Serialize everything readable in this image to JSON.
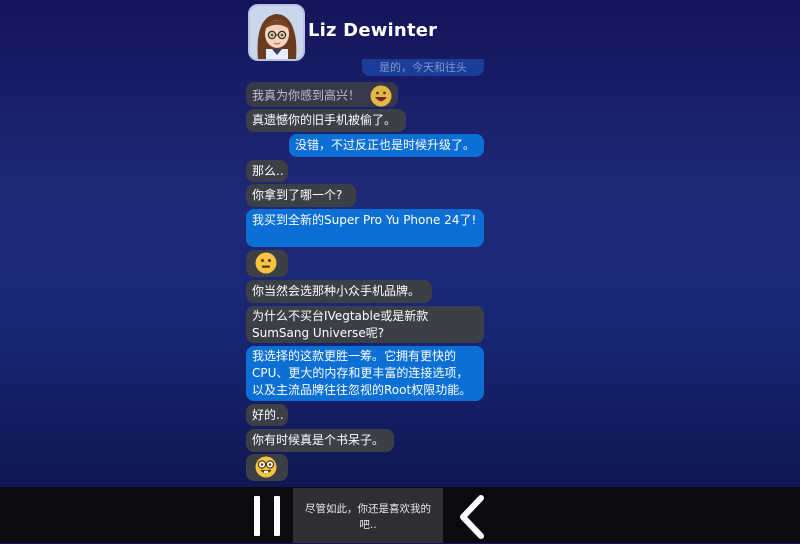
{
  "header": {
    "contact_name": "Liz Dewinter",
    "faded_text": "是的，今天和往头"
  },
  "messages": [
    {
      "side": "in",
      "text": "我真为你感到高兴！",
      "icon": "grin-emoji-icon"
    },
    {
      "side": "in",
      "text": "真遗憾你的旧手机被偷了。"
    },
    {
      "side": "out",
      "text": "没错，不过反正也是时候升级了。"
    },
    {
      "side": "in",
      "text": "那么.."
    },
    {
      "side": "in",
      "text": "你拿到了哪一个?"
    },
    {
      "side": "out",
      "text": "我买到全新的Super Pro Yu Phone 24了!"
    },
    {
      "side": "in",
      "icon": "surprised-emoji-icon"
    },
    {
      "side": "in",
      "text": "你当然会选那种小众手机品牌。"
    },
    {
      "side": "in",
      "text": "为什么不买台IVegtable或是新款SumSang Universe呢?"
    },
    {
      "side": "out",
      "text": "我选择的这款更胜一筹。它拥有更快的CPU、更大的内存和更丰富的连接选项，以及主流品牌往往忽视的Root权限功能。"
    },
    {
      "side": "in",
      "text": "好的.."
    },
    {
      "side": "in",
      "text": "你有时候真是个书呆子。"
    },
    {
      "side": "in",
      "icon": "nerd-emoji-icon"
    }
  ],
  "controls": {
    "choice_text": "尽管如此，你还是喜欢我的吧..",
    "pause_icon": "pause-icon",
    "back_icon": "chevron-left-icon"
  },
  "colors": {
    "incoming_bubble": "#3d3f47",
    "outgoing_bubble": "#0b6fd6",
    "bottom_bar": "#0a0a0f"
  }
}
